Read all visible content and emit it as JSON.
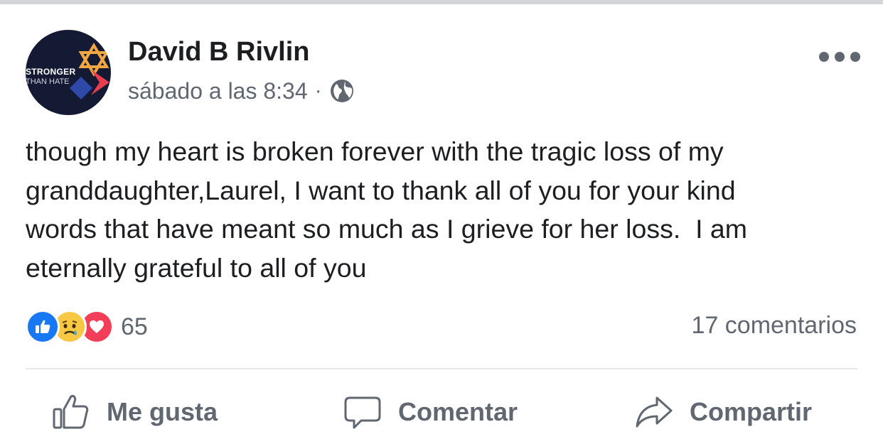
{
  "post": {
    "avatar": {
      "line1": "STRONGER",
      "line2": "THAN HATE"
    },
    "author": "David B Rivlin",
    "timestamp": "sábado a las 8:34",
    "separator": "·",
    "privacy_icon": "globe-icon",
    "menu_icon": "more-options-icon",
    "message": "though my heart is broken forever with the tragic loss of my\ngranddaughter,Laurel, I want to thank all of you for your kind\nwords that have meant so much as I grieve for her loss.  I am\neternally grateful to all of you"
  },
  "reactions": {
    "icons": [
      "like-reaction-icon",
      "sad-reaction-icon",
      "love-reaction-icon"
    ],
    "count": "65",
    "comments": "17 comentarios"
  },
  "actions": {
    "like_label": "Me gusta",
    "comment_label": "Comentar",
    "share_label": "Compartir"
  },
  "colors": {
    "text": "#1c1e21",
    "secondary": "#606770",
    "like_blue": "#1877f2",
    "love_red": "#f33e58",
    "sad_yellow": "#f7c843",
    "divider": "#e4e6eb",
    "avatar_bg": "#141a33"
  }
}
